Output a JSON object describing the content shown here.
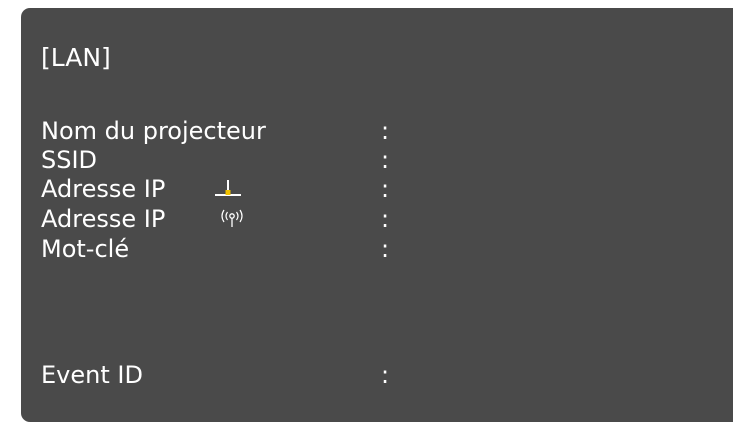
{
  "lan": {
    "title": "[LAN]",
    "rows": [
      {
        "label": "Nom du projecteur",
        "separator": ":"
      },
      {
        "label": "SSID",
        "separator": ":"
      },
      {
        "label": "Adresse IP",
        "separator": ":",
        "icon": "wired-lan-icon"
      },
      {
        "label": "Adresse IP",
        "separator": ":",
        "icon": "wireless-lan-icon"
      },
      {
        "label": "Mot-clé",
        "separator": ":"
      },
      {
        "label": "Event ID",
        "separator": ":"
      }
    ]
  },
  "colors": {
    "panel_background": "#4a4a4a",
    "text": "#ffffff",
    "wired_icon_accent": "#f2c200"
  }
}
